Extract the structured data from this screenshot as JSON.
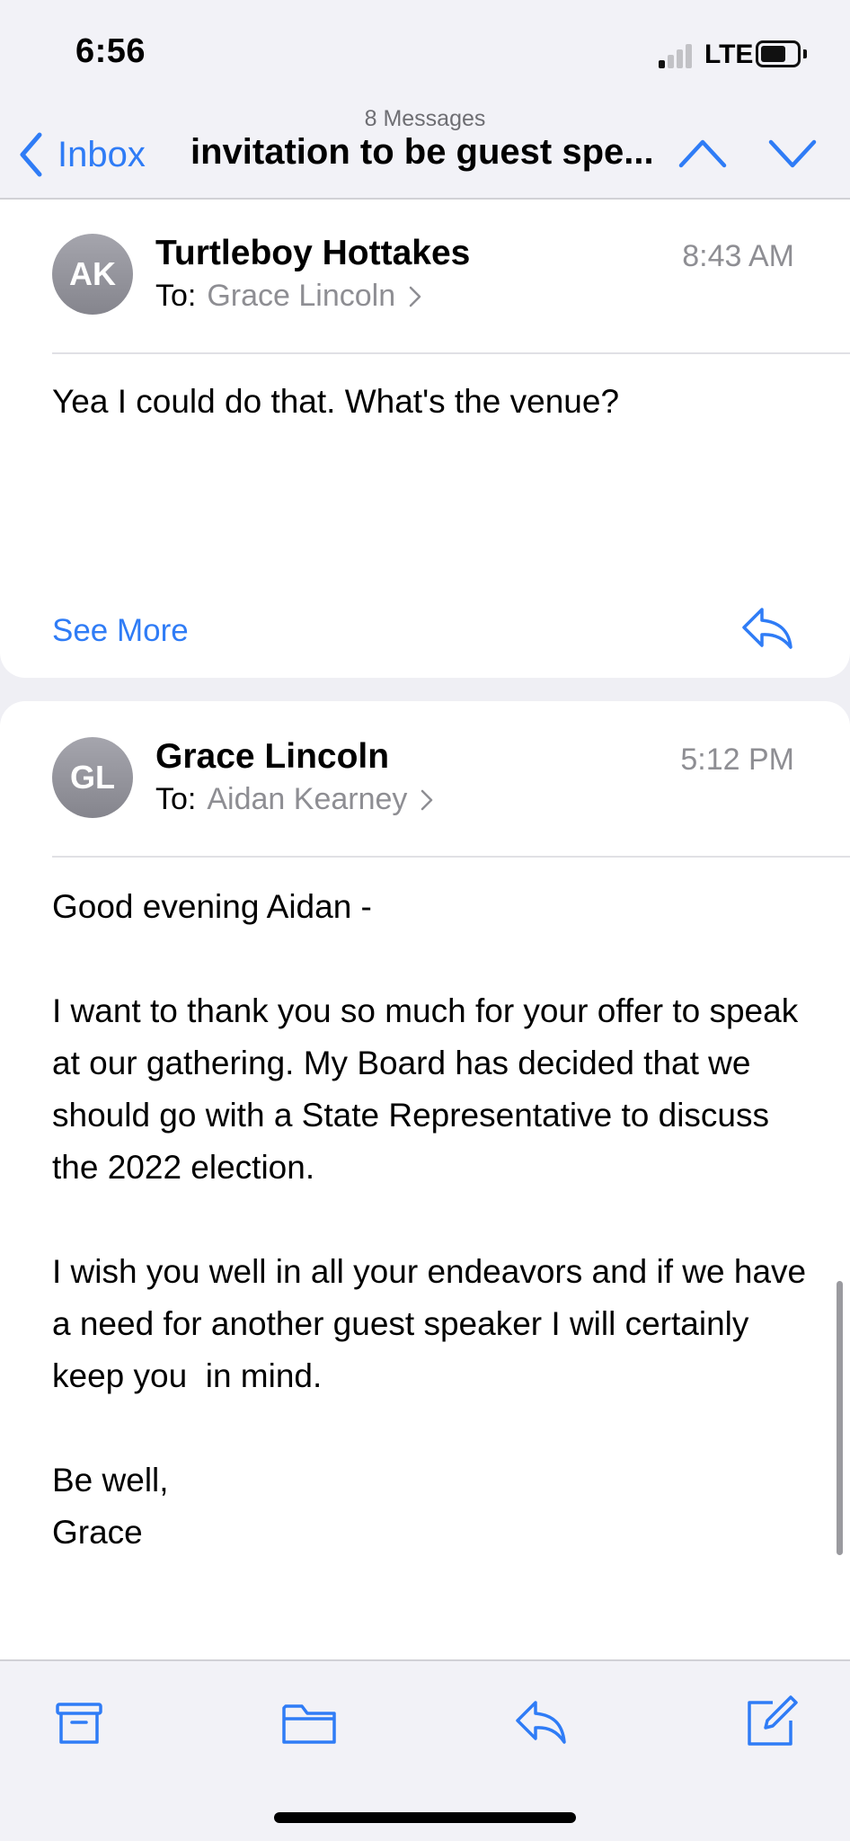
{
  "status": {
    "time": "6:56",
    "network": "LTE"
  },
  "nav": {
    "back_label": "Inbox",
    "message_count": "8 Messages",
    "title": "invitation to be guest spe..."
  },
  "messages": [
    {
      "initials": "AK",
      "sender": "Turtleboy Hottakes",
      "to_label": "To:",
      "to": "Grace Lincoln",
      "time": "8:43 AM",
      "body": "Yea I could do that. What's the venue?",
      "see_more": "See More"
    },
    {
      "initials": "GL",
      "sender": "Grace Lincoln",
      "to_label": "To:",
      "to": "Aidan Kearney",
      "time": "5:12 PM",
      "body": "Good evening Aidan -\n\nI want to thank you so much for your offer to speak at our gathering. My Board has decided that we should go with a State Representative to discuss the 2022 election.\n\nI wish you well in all your endeavors and if we have a need for another guest speaker I will certainly keep you  in mind.\n\nBe well,\nGrace"
    }
  ],
  "toolbar": {
    "icons": [
      "archive-icon",
      "folder-icon",
      "reply-icon",
      "compose-icon"
    ]
  },
  "colors": {
    "accent": "#2f7cf6",
    "secondary_text": "#8e8e93"
  }
}
